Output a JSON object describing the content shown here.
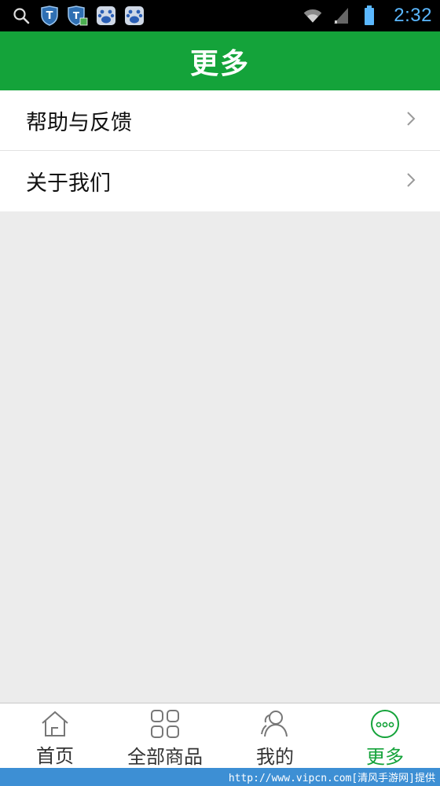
{
  "status_bar": {
    "time": "2:32",
    "left_icons": [
      "search-icon",
      "shield-t-icon",
      "shield-t-grid-icon",
      "baidu-paw-icon",
      "baidu-paw-icon"
    ],
    "right_icons": [
      "wifi-icon",
      "signal-icon",
      "battery-icon"
    ]
  },
  "header": {
    "title": "更多"
  },
  "menu": {
    "items": [
      {
        "label": "帮助与反馈",
        "icon": "chevron-right-icon"
      },
      {
        "label": "关于我们",
        "icon": "chevron-right-icon"
      }
    ]
  },
  "tab_bar": {
    "tabs": [
      {
        "label": "首页",
        "icon": "home-icon",
        "active": false
      },
      {
        "label": "全部商品",
        "icon": "grid-icon",
        "active": false
      },
      {
        "label": "我的",
        "icon": "user-icon",
        "active": false
      },
      {
        "label": "更多",
        "icon": "more-icon",
        "active": true
      }
    ]
  },
  "watermark": {
    "text": "http://www.vipcn.com[清风手游网]提供"
  },
  "colors": {
    "header_bg": "#14a33a",
    "active_tab": "#14a33a",
    "time_color": "#5bb8ff",
    "watermark_bg": "#3d8fd4",
    "page_bg": "#ececec"
  }
}
